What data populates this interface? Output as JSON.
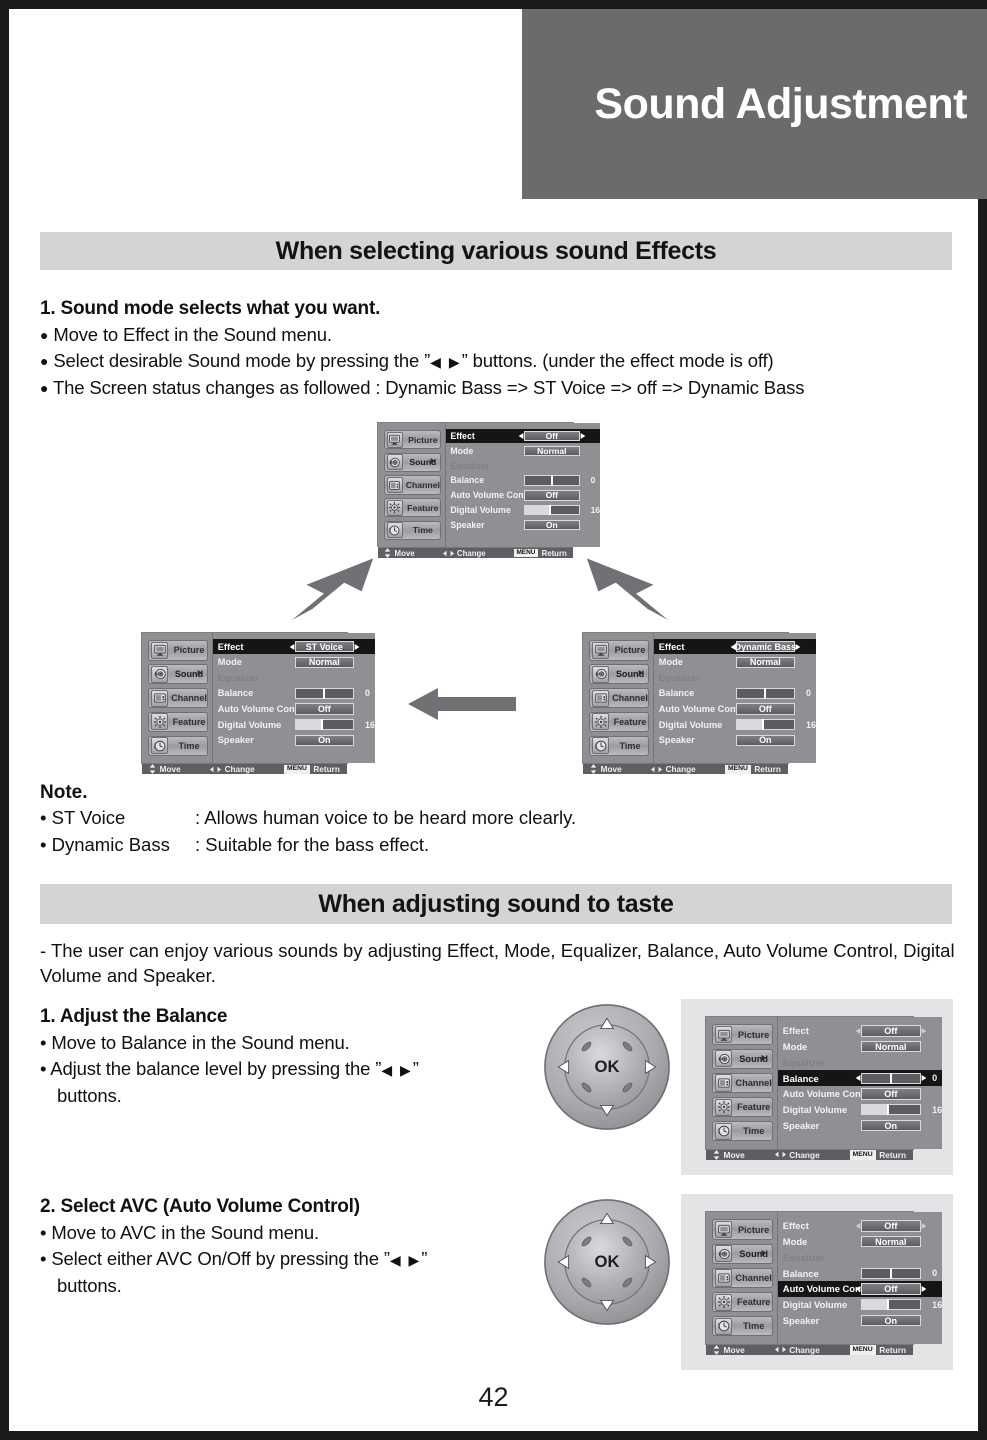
{
  "document": {
    "page_number": "42",
    "masthead_title": "Sound Adjustment"
  },
  "sections": {
    "effects": {
      "heading": "When selecting various sound Effects"
    },
    "taste": {
      "heading": "When adjusting sound to taste"
    }
  },
  "step1": {
    "title": "1. Sound mode selects what you want.",
    "bullets": [
      "Move to Effect in the Sound menu.",
      "Select desirable Sound mode by pressing the \" ◀ ▶ \" buttons. (under the effect mode is off)",
      "The Screen status changes as followed : Dynamic Bass => ST Voice => off => Dynamic Bass"
    ],
    "bullet2_pre": "Select desirable Sound mode by pressing the ”",
    "bullet2_arrows": "◀ ▶",
    "bullet2_post": "” buttons. (under the effect mode is off)"
  },
  "note": {
    "title": "Note.",
    "rows": [
      {
        "term": "• ST Voice",
        "desc": ": Allows human voice to be heard more clearly."
      },
      {
        "term": "• Dynamic Bass",
        "desc": ": Suitable for the bass effect."
      }
    ]
  },
  "taste_intro": "- The user can enjoy various sounds by adjusting Effect, Mode, Equalizer, Balance, Auto Volume Control, Digital Volume and Speaker.",
  "balance_step": {
    "title": "1. Adjust the Balance",
    "bullet1": "• Move to Balance in the Sound menu.",
    "bullet2_pre": "• Adjust the balance level by pressing the ”",
    "bullet2_arrows": "◀ ▶",
    "bullet2_post": "”",
    "bullet2_cont": "buttons."
  },
  "avc_step": {
    "title": "2. Select AVC (Auto Volume Control)",
    "bullet1": "• Move to AVC in the Sound menu.",
    "bullet2_pre": "• Select either AVC On/Off by pressing the ”",
    "bullet2_arrows": "◀ ▶",
    "bullet2_post": "”",
    "bullet2_cont": "buttons."
  },
  "osd": {
    "sidebar": [
      {
        "label": "Picture",
        "icon": "monitor-icon",
        "active": false
      },
      {
        "label": "Sound",
        "icon": "speaker-icon",
        "active": true
      },
      {
        "label": "Channel",
        "icon": "tv-channel-icon",
        "active": false
      },
      {
        "label": "Feature",
        "icon": "gear-icon",
        "active": false
      },
      {
        "label": "Time",
        "icon": "clock-icon",
        "active": false
      }
    ],
    "footer": {
      "move_label": "Move",
      "move_icon": "up-down-arrows-icon",
      "change_label": "Change",
      "change_icon": "left-right-arrows-icon",
      "menu_key": "MENU",
      "return_label": "Return"
    },
    "rows": {
      "effect": "Effect",
      "mode": "Mode",
      "equalizer": "Equalizer",
      "balance": "Balance",
      "avc": "Auto Volume Control",
      "digital_volume": "Digital Volume",
      "speaker": "Speaker"
    },
    "values": {
      "effect_off": "Off",
      "effect_st_voice": "ST Voice",
      "effect_dynamic_bass": "Dynamic Bass",
      "mode": "Normal",
      "balance_value": "0",
      "avc": "Off",
      "digital_volume_value": "16",
      "speaker": "On"
    }
  },
  "screens": [
    {
      "id": "screen-off",
      "effect_value": "Off",
      "selected_row": "effect"
    },
    {
      "id": "screen-st-voice",
      "effect_value": "ST Voice",
      "selected_row": "effect"
    },
    {
      "id": "screen-dynamic-bass",
      "effect_value": "Dynamic Bass",
      "selected_row": "effect"
    },
    {
      "id": "screen-balance",
      "effect_value": "Off",
      "selected_row": "balance"
    },
    {
      "id": "screen-avc",
      "effect_value": "Off",
      "selected_row": "avc"
    }
  ],
  "dpad": {
    "ok_label": "OK",
    "up_icon": "triangle-up-icon",
    "down_icon": "triangle-down-icon",
    "left_icon": "triangle-left-icon",
    "right_icon": "triangle-right-icon"
  },
  "colors": {
    "masthead_bg": "#6b6b6b",
    "section_bar_bg": "#d2d4d6",
    "osd_bg": "#8e9093",
    "osd_selected": "#151515",
    "border": "#1a1a1a"
  }
}
